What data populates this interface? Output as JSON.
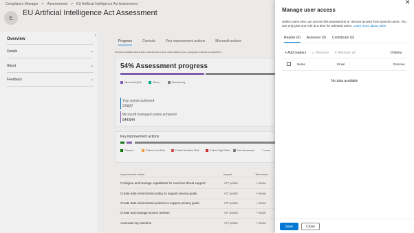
{
  "breadcrumb": [
    "Compliance Manager",
    "Assessments",
    "EU Artificial Intelligence Act Assessment"
  ],
  "page": {
    "avatar_letter": "E",
    "title": "EU Artificial Intelligence Act Assessment"
  },
  "left_nav": {
    "overview": "Overview",
    "items": [
      "Details",
      "About",
      "Feedback"
    ]
  },
  "tabs": [
    "Progress",
    "Controls",
    "Your improvement actions",
    "Microsoft actions"
  ],
  "review_text": "Review details about this assessment and understand your progress toward completion.",
  "progress": {
    "title": "54% Assessment progress",
    "value_pct": 54,
    "legend": [
      "Microsoft (84)",
      "Other",
      "Remaining"
    ],
    "your_points_label": "Your points achieved",
    "your_points_value": "27/827",
    "ms_points_label": "Microsoft managed points achieved",
    "ms_points_value": "944/944"
  },
  "key_actions": {
    "title": "Key improvement actions",
    "legend": [
      "Passed",
      "Failed Low Risk",
      "Failed Medium Risk",
      "Failed High Risk",
      "Not Assessed",
      "1 more"
    ]
  },
  "table": {
    "headers": [
      "Improvement action",
      "Impact",
      "Test status"
    ],
    "rows": [
      {
        "action": "Configure and manage capabilities for real-time threat support",
        "impact": "+27 points",
        "status": "• None"
      },
      {
        "action": "Create data minimization policy to support privacy goals",
        "impact": "+27 points",
        "status": "• None"
      },
      {
        "action": "Create data minimization policies to support privacy goals",
        "impact": "+27 points",
        "status": "• None"
      },
      {
        "action": "Create and manage access reviews",
        "impact": "+27 points",
        "status": "• None"
      },
      {
        "action": "Automate log retention",
        "impact": "+27 points",
        "status": "• None"
      }
    ]
  },
  "panel": {
    "title": "Manage user access",
    "description": "Select users who can access this assessment or remove access from specific users. You can only pick one role at a time for selected users.",
    "learn_more": "Learn more about roles",
    "tabs": [
      "Reader (0)",
      "Assessor (0)",
      "Contributor (0)"
    ],
    "add": "Add readers",
    "remove": "Remove",
    "remove_all": "Remove all",
    "count": "0 items",
    "columns": [
      "Name",
      "Email",
      "Remove"
    ],
    "empty": "No data available",
    "save": "Save",
    "close": "Close"
  },
  "colors": {
    "accent": "#0078d4",
    "microsoft": "#8764b8",
    "other": "#00b294",
    "remaining": "#8a8886",
    "passed": "#107c10",
    "failed_low": "#ffaa44",
    "failed_medium": "#e05a5a",
    "failed_high": "#d13438",
    "not_assessed": "#8a8886"
  }
}
